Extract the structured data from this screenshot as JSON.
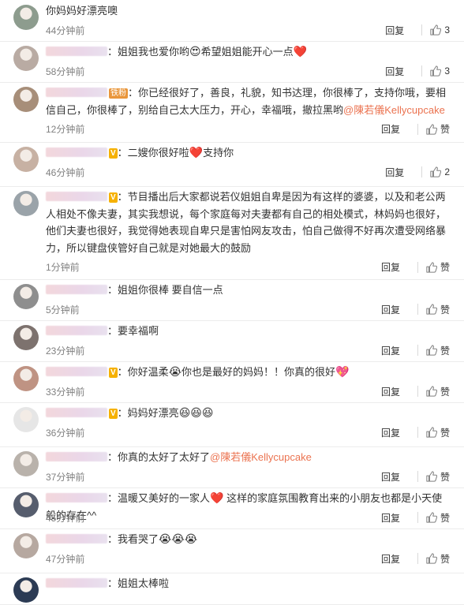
{
  "reply_label": "回复",
  "like_label": "赞",
  "comments": [
    {
      "avatar_color": "#8d9c8e",
      "segments": [
        {
          "t": "你妈妈好漂亮噢"
        }
      ],
      "time": "44分钟前",
      "likes": "3",
      "badge": ""
    },
    {
      "avatar_color": "#b9aba3",
      "segments": [
        {
          "t": "：姐姐我也爱你哟"
        },
        {
          "e": "😍"
        },
        {
          "t": "希望姐姐能开心一点"
        },
        {
          "h": "❤️"
        }
      ],
      "time": "58分钟前",
      "likes": "3",
      "badge": ""
    },
    {
      "avatar_color": "#a78e79",
      "segments": [
        {
          "t": "：你已经很好了，善良，礼貌，知书达理，你很棒了，支持你哦，要相信自己，你很棒了，别给自己太大压力，开心，幸福哦，撤拉黑哟"
        },
        {
          "m": "@陳若儀Kellycupcake"
        }
      ],
      "time": "12分钟前",
      "likes": "",
      "badge": "铁粉"
    },
    {
      "avatar_color": "#c7b1a3",
      "segments": [
        {
          "t": "：二嫂你很好啦"
        },
        {
          "h": "❤️"
        },
        {
          "t": "支持你"
        }
      ],
      "time": "46分钟前",
      "likes": "2",
      "badge": "V"
    },
    {
      "avatar_color": "#9aa3a9",
      "segments": [
        {
          "t": "：节目播出后大家都说若仪姐姐自卑是因为有这样的婆婆，以及和老公两人相处不像夫妻，其实我想说，每个家庭每对夫妻都有自己的相处模式，林妈妈也很好，他们夫妻也很好，我觉得她表现自卑只是害怕网友攻击，怕自己做得不好再次遭受网络暴力，所以键盘侠管好自己就是对她最大的鼓励"
        }
      ],
      "time": "1分钟前",
      "likes": "",
      "badge": "V"
    },
    {
      "avatar_color": "#8e8e8e",
      "segments": [
        {
          "t": "：姐姐你很棒 要自信一点"
        }
      ],
      "time": "5分钟前",
      "likes": "",
      "badge": ""
    },
    {
      "avatar_color": "#7d726e",
      "segments": [
        {
          "t": "：要幸福啊"
        }
      ],
      "time": "23分钟前",
      "likes": "",
      "badge": ""
    },
    {
      "avatar_color": "#bf9383",
      "segments": [
        {
          "t": "：你好温柔"
        },
        {
          "e": "😭"
        },
        {
          "t": "你也是最好的妈妈！！你真的很好"
        },
        {
          "h": "💖"
        }
      ],
      "time": "33分钟前",
      "likes": "",
      "badge": "V"
    },
    {
      "avatar_color": "#e6e6e6",
      "segments": [
        {
          "t": "：妈妈好漂亮"
        },
        {
          "e": "😆😆😆"
        }
      ],
      "time": "36分钟前",
      "likes": "",
      "badge": "V"
    },
    {
      "avatar_color": "#b9b2ab",
      "segments": [
        {
          "t": "：你真的太好了太好了"
        },
        {
          "m": "@陳若儀Kellycupcake"
        }
      ],
      "time": "37分钟前",
      "likes": "",
      "badge": ""
    },
    {
      "avatar_color": "#565d6d",
      "segments": [
        {
          "t": "：温暖又美好的一家人"
        },
        {
          "h": "❤️"
        },
        {
          "t": " 这样的家庭氛围教育出来的小朋友也都是小天使般的存在^^"
        }
      ],
      "time": "45分钟前",
      "likes": "",
      "badge": ""
    },
    {
      "avatar_color": "#b6a8a0",
      "segments": [
        {
          "t": "：我看哭了"
        },
        {
          "e": "😭😭😭"
        }
      ],
      "time": "47分钟前",
      "likes": "",
      "badge": ""
    },
    {
      "avatar_color": "#2c3b54",
      "segments": [
        {
          "t": "：姐姐太棒啦"
        }
      ],
      "time": "",
      "likes": "",
      "badge": ""
    }
  ]
}
